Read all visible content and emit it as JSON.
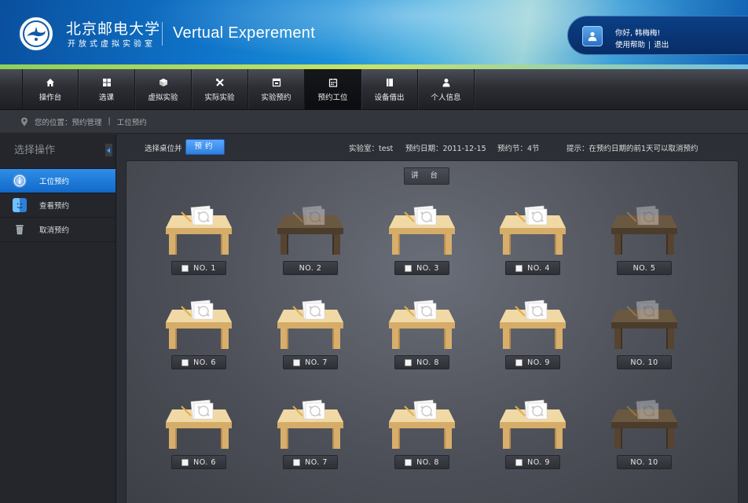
{
  "header": {
    "university_name": "北京邮电大学",
    "university_subtitle": "开放式虚拟实验室",
    "app_title": "Vertual Experement",
    "user_greeting": "你好, 韩梅梅!",
    "help_link": "使用帮助",
    "link_separator": "|",
    "logout_link": "退出"
  },
  "nav": {
    "items": [
      {
        "label": "操作台",
        "icon": "home-icon"
      },
      {
        "label": "选课",
        "icon": "grid-icon"
      },
      {
        "label": "虚拟实验",
        "icon": "cube-icon"
      },
      {
        "label": "实际实验",
        "icon": "tools-icon"
      },
      {
        "label": "实验预约",
        "icon": "calendar-icon"
      },
      {
        "label": "预约工位",
        "icon": "calendar-grid-icon",
        "active": true
      },
      {
        "label": "设备借出",
        "icon": "book-icon"
      },
      {
        "label": "个人信息",
        "icon": "person-icon"
      }
    ]
  },
  "breadcrumb": {
    "prefix": "您的位置：预约管理",
    "separator": "|",
    "current": "工位预约"
  },
  "sidebar": {
    "title": "选择操作",
    "items": [
      {
        "label": "工位预约",
        "icon": "info-icon",
        "active": true
      },
      {
        "label": "查看预约",
        "icon": "finder-icon"
      },
      {
        "label": "取消预约",
        "icon": "trash-icon"
      }
    ]
  },
  "toolbar": {
    "select_label": "选择桌位并",
    "book_button": "预约",
    "lab": "实验室：test",
    "date": "预约日期：2011-12-15",
    "session": "预约节：4节",
    "hint": "提示：在预约日期的前1天可以取消预约"
  },
  "room": {
    "podium": "讲 台",
    "desks": [
      {
        "label": "NO. 1",
        "available": true
      },
      {
        "label": "NO. 2",
        "available": false
      },
      {
        "label": "NO. 3",
        "available": true
      },
      {
        "label": "NO. 4",
        "available": true
      },
      {
        "label": "NO. 5",
        "available": false
      },
      {
        "label": "NO. 6",
        "available": true
      },
      {
        "label": "NO. 7",
        "available": true
      },
      {
        "label": "NO. 8",
        "available": true
      },
      {
        "label": "NO. 9",
        "available": true
      },
      {
        "label": "NO. 10",
        "available": false
      },
      {
        "label": "NO. 6",
        "available": true
      },
      {
        "label": "NO. 7",
        "available": true
      },
      {
        "label": "NO. 8",
        "available": true
      },
      {
        "label": "NO. 9",
        "available": true
      },
      {
        "label": "NO. 10",
        "available": false
      }
    ]
  },
  "colors": {
    "accent_blue": "#2f7fe0",
    "desk_available": "#e7c58c",
    "desk_occupied": "#5e4a33"
  }
}
